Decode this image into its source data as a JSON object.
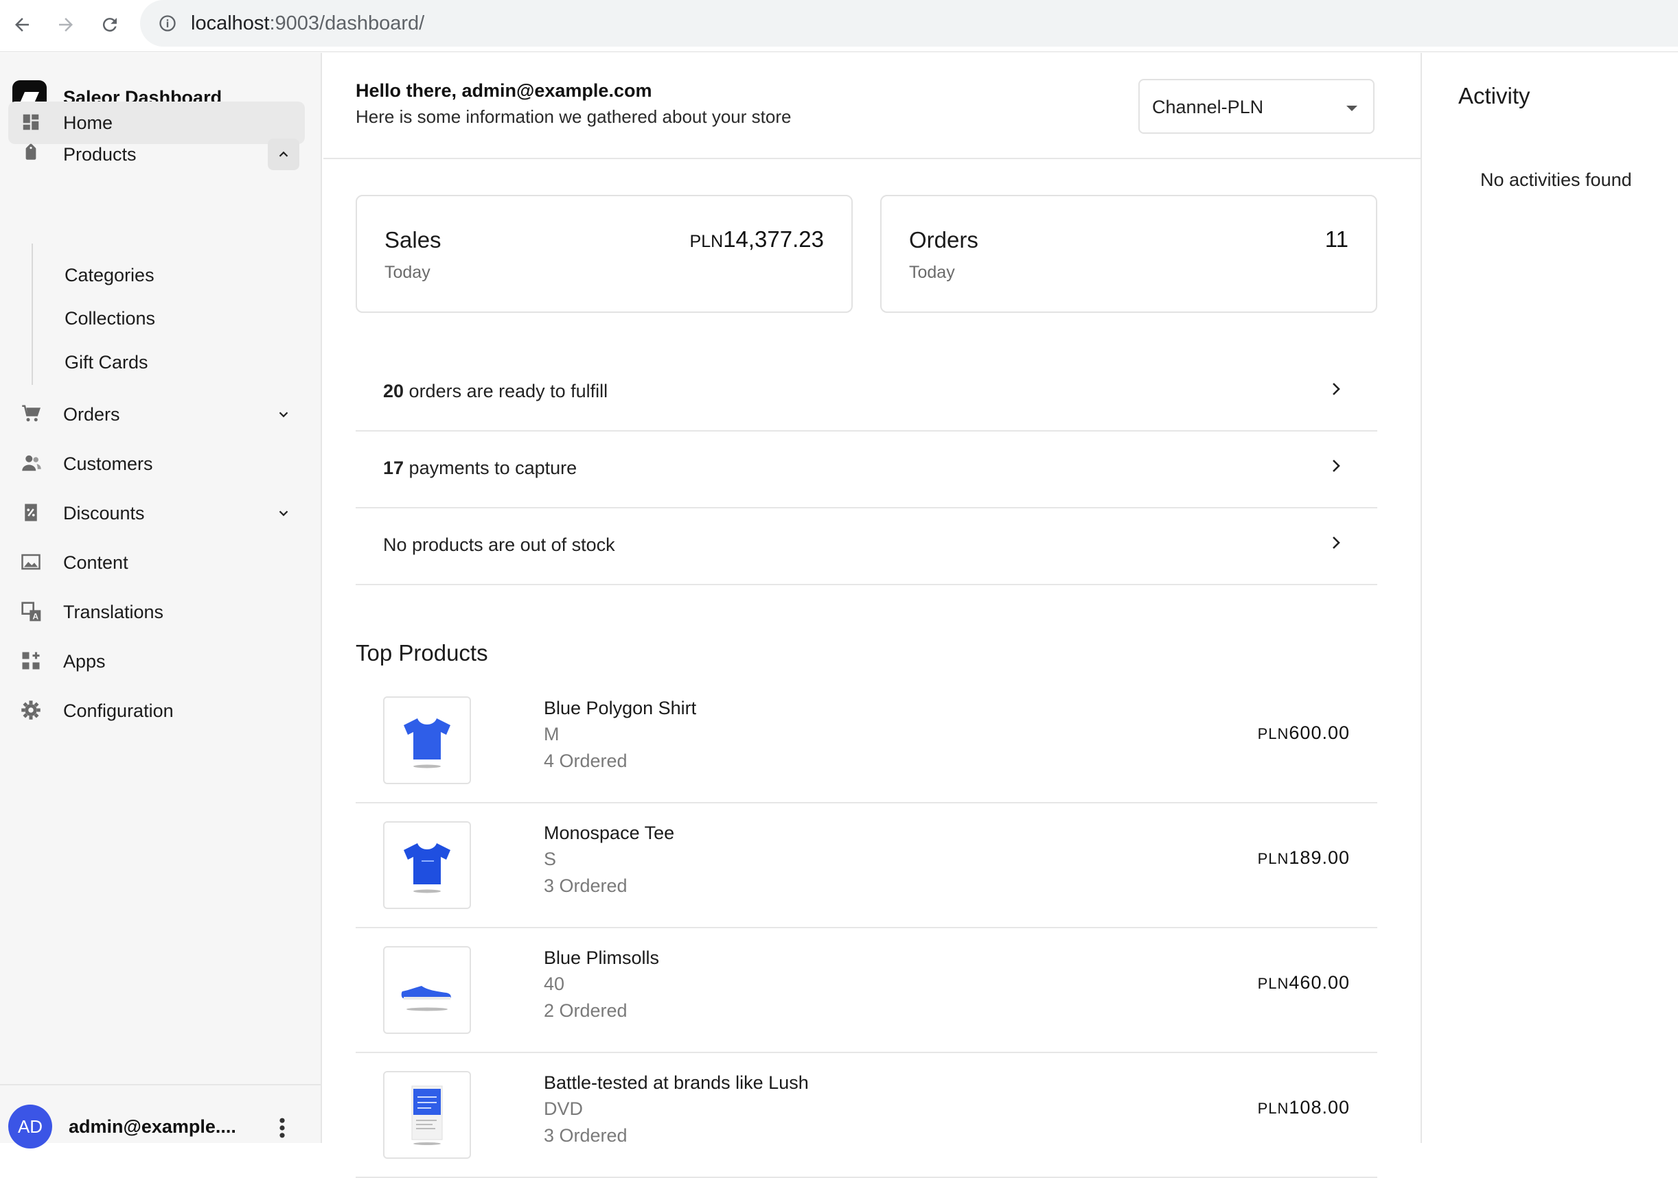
{
  "browser": {
    "url_host": "localhost",
    "url_rest": ":9003/dashboard/"
  },
  "sidebar": {
    "brand": "Saleor Dashboard",
    "items": [
      {
        "label": "Home"
      },
      {
        "label": "Products"
      },
      {
        "label": "Orders"
      },
      {
        "label": "Customers"
      },
      {
        "label": "Discounts"
      },
      {
        "label": "Content"
      },
      {
        "label": "Translations"
      },
      {
        "label": "Apps"
      },
      {
        "label": "Configuration"
      }
    ],
    "product_sub": [
      "Categories",
      "Collections",
      "Gift Cards"
    ],
    "user": {
      "initials": "AD",
      "email": "admin@example...."
    }
  },
  "header": {
    "greeting": "Hello there, admin@example.com",
    "subtitle": "Here is some information we gathered about your store",
    "channel": "Channel-PLN"
  },
  "stats": {
    "sales": {
      "title": "Sales",
      "period": "Today",
      "currency": "PLN",
      "value": "14,377.23"
    },
    "orders": {
      "title": "Orders",
      "period": "Today",
      "value": "11"
    }
  },
  "notices": [
    {
      "count": "20",
      "text": " orders are ready to fulfill"
    },
    {
      "count": "17",
      "text": " payments to capture"
    },
    {
      "count": "",
      "text": "No products are out of stock"
    }
  ],
  "top_products": {
    "title": "Top Products",
    "items": [
      {
        "name": "Blue Polygon Shirt",
        "variant": "M",
        "ordered": "4 Ordered",
        "currency": "PLN",
        "price": "600.00"
      },
      {
        "name": "Monospace Tee",
        "variant": "S",
        "ordered": "3 Ordered",
        "currency": "PLN",
        "price": "189.00"
      },
      {
        "name": "Blue Plimsolls",
        "variant": "40",
        "ordered": "2 Ordered",
        "currency": "PLN",
        "price": "460.00"
      },
      {
        "name": "Battle-tested at brands like Lush",
        "variant": "DVD",
        "ordered": "3 Ordered",
        "currency": "PLN",
        "price": "108.00"
      }
    ]
  },
  "activity": {
    "title": "Activity",
    "empty": "No activities found"
  }
}
